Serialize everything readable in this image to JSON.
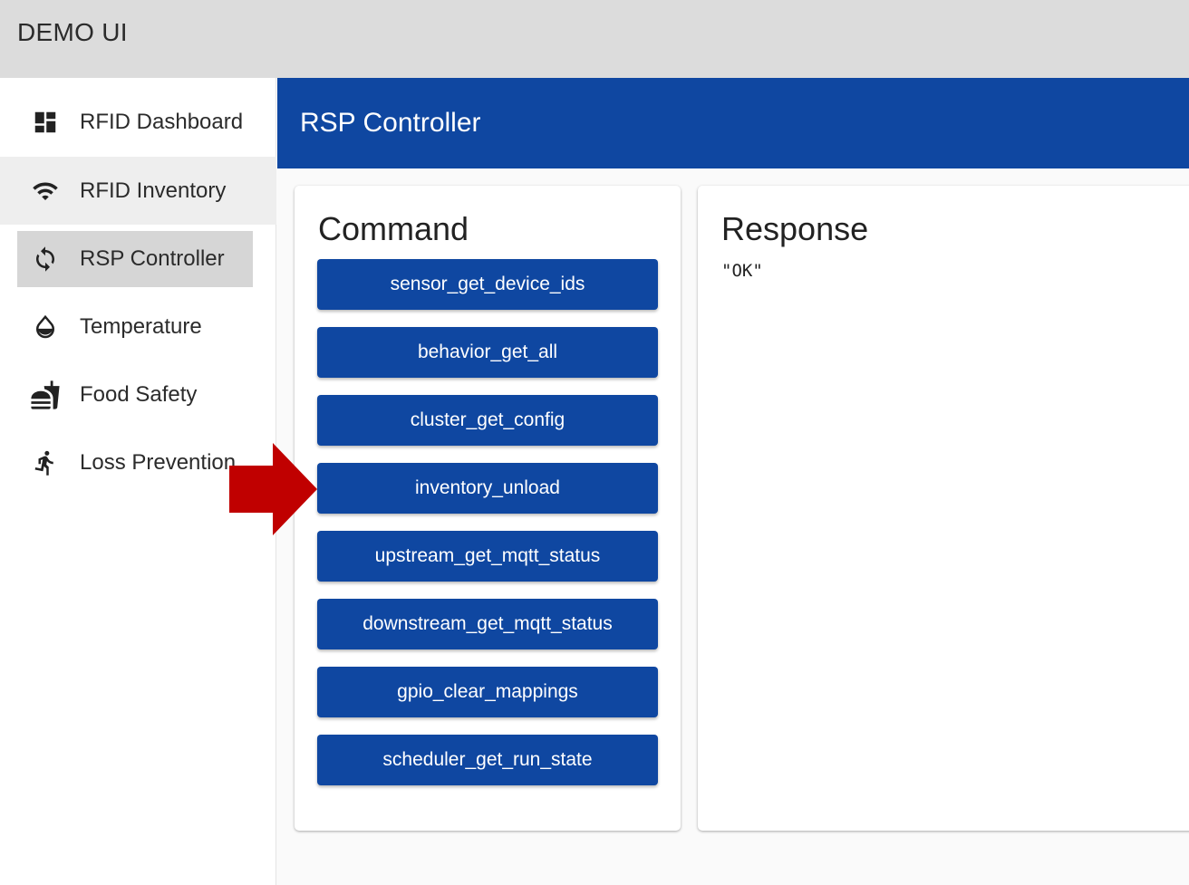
{
  "app": {
    "title": "DEMO UI"
  },
  "sidebar": {
    "items": [
      {
        "label": "RFID Dashboard",
        "icon": "dashboard-icon"
      },
      {
        "label": "RFID Inventory",
        "icon": "wifi-icon"
      },
      {
        "label": "RSP Controller",
        "icon": "sync-icon"
      },
      {
        "label": "Temperature",
        "icon": "drop-icon"
      },
      {
        "label": "Food Safety",
        "icon": "fastfood-icon"
      },
      {
        "label": "Loss Prevention",
        "icon": "running-person-icon"
      }
    ],
    "active": "RSP Controller",
    "hovered": "RFID Inventory"
  },
  "header": {
    "title": "RSP Controller"
  },
  "command": {
    "heading": "Command",
    "buttons": [
      "sensor_get_device_ids",
      "behavior_get_all",
      "cluster_get_config",
      "inventory_unload",
      "upstream_get_mqtt_status",
      "downstream_get_mqtt_status",
      "gpio_clear_mappings",
      "scheduler_get_run_state"
    ]
  },
  "response": {
    "heading": "Response",
    "body": "\"OK\""
  },
  "colors": {
    "primary": "#0f47a1",
    "topbar": "#dcdcdc",
    "active_nav": "#d6d6d6",
    "arrow": "#c00000"
  }
}
